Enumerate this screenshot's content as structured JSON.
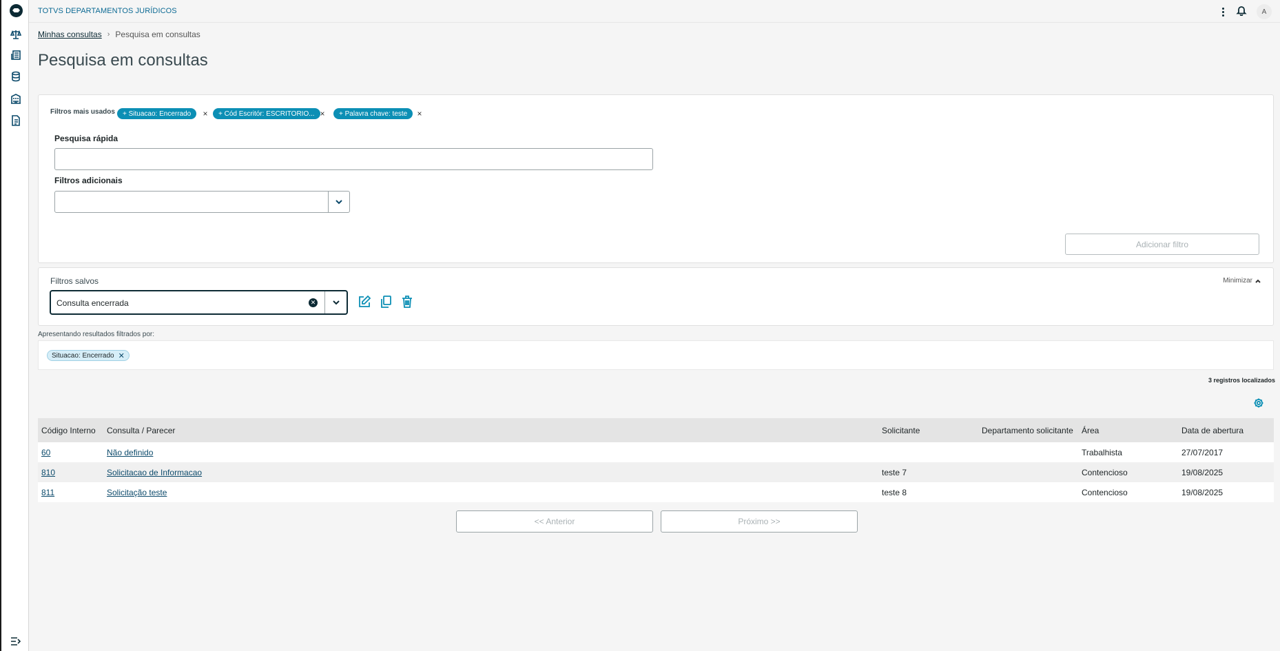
{
  "app": {
    "title": "TOTVS DEPARTAMENTOS JURÍDICOS",
    "avatar_initial": "A"
  },
  "breadcrumb": {
    "link": "Minhas consultas",
    "current": "Pesquisa em consultas"
  },
  "page": {
    "title": "Pesquisa em consultas"
  },
  "filters": {
    "most_used_label": "Filtros mais usados",
    "chips": [
      "+ Situacao: Encerrado",
      "+ Cód Escritór: ESCRITORIO...",
      "+ Palavra chave: teste"
    ],
    "quick_search_label": "Pesquisa rápida",
    "quick_search_value": "",
    "additional_label": "Filtros adicionais",
    "additional_value": "",
    "add_button": "Adicionar filtro"
  },
  "saved_filters": {
    "title": "Filtros salvos",
    "minimize": "Minimizar",
    "selected": "Consulta encerrada"
  },
  "results": {
    "label": "Apresentando resultados filtrados por:",
    "active_chip": "Situacao: Encerrado",
    "records": "3 registros localizados"
  },
  "table": {
    "columns": [
      "Código Interno",
      "Consulta / Parecer",
      "Solicitante",
      "Departamento solicitante",
      "Área",
      "Data de abertura"
    ],
    "rows": [
      {
        "code": "60",
        "consulta": "Não definido",
        "solicitante": "",
        "departamento": "",
        "area": "Trabalhista",
        "data": "27/07/2017"
      },
      {
        "code": "810",
        "consulta": "Solicitacao de Informacao",
        "solicitante": "teste 7",
        "departamento": "",
        "area": "Contencioso",
        "data": "19/08/2025"
      },
      {
        "code": "811",
        "consulta": "Solicitação teste",
        "solicitante": "teste 8",
        "departamento": "",
        "area": "Contencioso",
        "data": "19/08/2025"
      }
    ]
  },
  "pagination": {
    "prev": "<< Anterior",
    "next": "Próximo >>"
  },
  "colors": {
    "accent": "#0c8fb5",
    "dark": "#0c2a34",
    "link": "#0c4a6b"
  }
}
